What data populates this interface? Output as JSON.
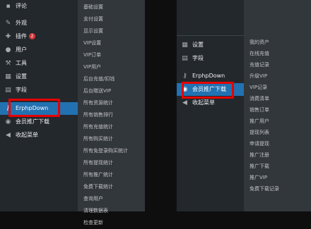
{
  "left_sidebar": {
    "items": [
      {
        "icon": "comments-icon",
        "label": "评论"
      },
      {
        "icon": "appearance-icon",
        "label": "外观"
      },
      {
        "icon": "plugins-icon",
        "label": "插件",
        "badge": "2"
      },
      {
        "icon": "users-icon",
        "label": "用户"
      },
      {
        "icon": "tools-icon",
        "label": "工具"
      },
      {
        "icon": "settings-icon",
        "label": "设置"
      },
      {
        "icon": "fields-icon",
        "label": "字段"
      },
      {
        "icon": "key-icon",
        "label": "ErphpDown"
      },
      {
        "icon": "globe-icon",
        "label": "会员推广下载"
      },
      {
        "icon": "collapse-icon",
        "label": "收起菜单"
      }
    ]
  },
  "left_flyout": {
    "items": [
      "基础设置",
      "支付设置",
      "显示设置",
      "VIP设置",
      "VIP订单",
      "VIP用户",
      "后台充值/扣钱",
      "后台赠送VIP",
      "所有资源统计",
      "所有销售排行",
      "所有充值统计",
      "所有购买统计",
      "所有免登录购买统计",
      "所有提现统计",
      "所有推广统计",
      "免费下载统计",
      "查询用户",
      "清理数据表",
      "检查更新"
    ]
  },
  "right_sidebar": {
    "items": [
      {
        "icon": "settings-icon",
        "label": "设置"
      },
      {
        "icon": "fields-icon",
        "label": "字段"
      },
      {
        "icon": "key-icon",
        "label": "ErphpDown"
      },
      {
        "icon": "globe-icon",
        "label": "会员推广下载"
      },
      {
        "icon": "collapse-icon",
        "label": "收起菜单"
      }
    ]
  },
  "right_flyout": {
    "items": [
      "我的资产",
      "在线充值",
      "充值记录",
      "升级VIP",
      "VIP记录",
      "消费清单",
      "销售订单",
      "推广用户",
      "提现列表",
      "申请提现",
      "推广注册",
      "推广下载",
      "推广VIP",
      "免费下载记录"
    ]
  },
  "colors": {
    "highlight": "#e60000",
    "active": "#2271b1",
    "sidebar": "#23282d",
    "flyout": "#32373c"
  }
}
